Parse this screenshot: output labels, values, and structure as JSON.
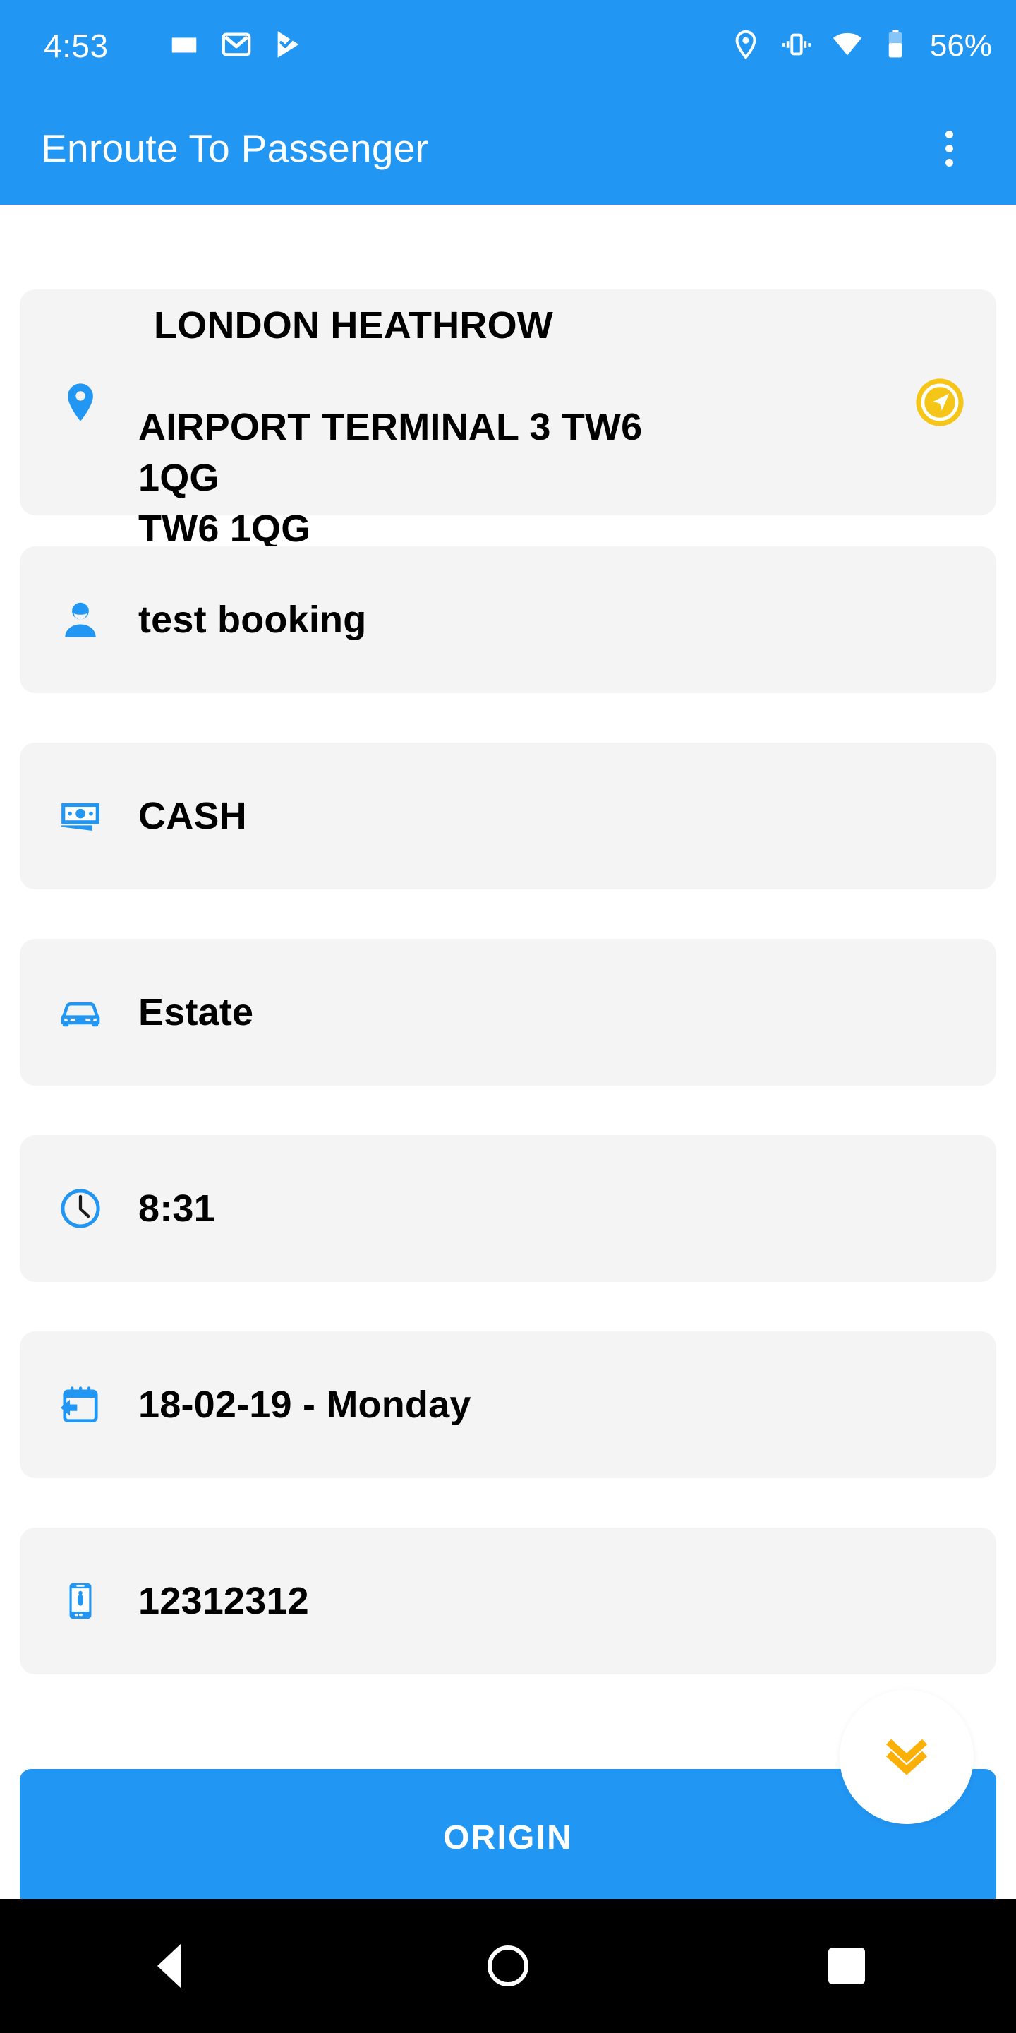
{
  "colors": {
    "primary": "#2196f3",
    "card_bg": "#f4f4f4",
    "accent_yellow": "#f5c518",
    "accent_orange": "#fbb007",
    "text": "#000000",
    "nav_bar": "#000000"
  },
  "status_bar": {
    "clock": "4:53",
    "battery_percent": "56%",
    "left_icons": [
      "screenshot-icon",
      "gmail-icon",
      "play-store-icon"
    ],
    "right_icons": [
      "location-icon",
      "vibrate-icon",
      "wifi-icon",
      "battery-icon"
    ]
  },
  "app_bar": {
    "title": "Enroute To Passenger",
    "overflow_menu": "more-options"
  },
  "rows": [
    {
      "id": "address",
      "icon": "map-pin-icon",
      "line1": "LONDON HEATHROW",
      "line2": "AIRPORT TERMINAL 3 TW6",
      "line3": "1QG",
      "line4": "TW6 1QG",
      "action_icon": "navigate-icon"
    },
    {
      "id": "passenger",
      "icon": "person-icon",
      "value": "test booking"
    },
    {
      "id": "payment",
      "icon": "cash-icon",
      "value": "CASH"
    },
    {
      "id": "vehicle",
      "icon": "car-icon",
      "value": "Estate"
    },
    {
      "id": "time",
      "icon": "clock-icon",
      "value": "8:31"
    },
    {
      "id": "date",
      "icon": "calendar-icon",
      "value": "18-02-19 - Monday"
    },
    {
      "id": "phone",
      "icon": "mobile-icon",
      "value": "12312312"
    }
  ],
  "fab": {
    "icon": "double-chevron-down-icon"
  },
  "primary_button": {
    "label": "ORIGIN"
  },
  "nav_bar": {
    "back": "back-triangle-icon",
    "home": "home-circle-icon",
    "recents": "recents-square-icon"
  }
}
